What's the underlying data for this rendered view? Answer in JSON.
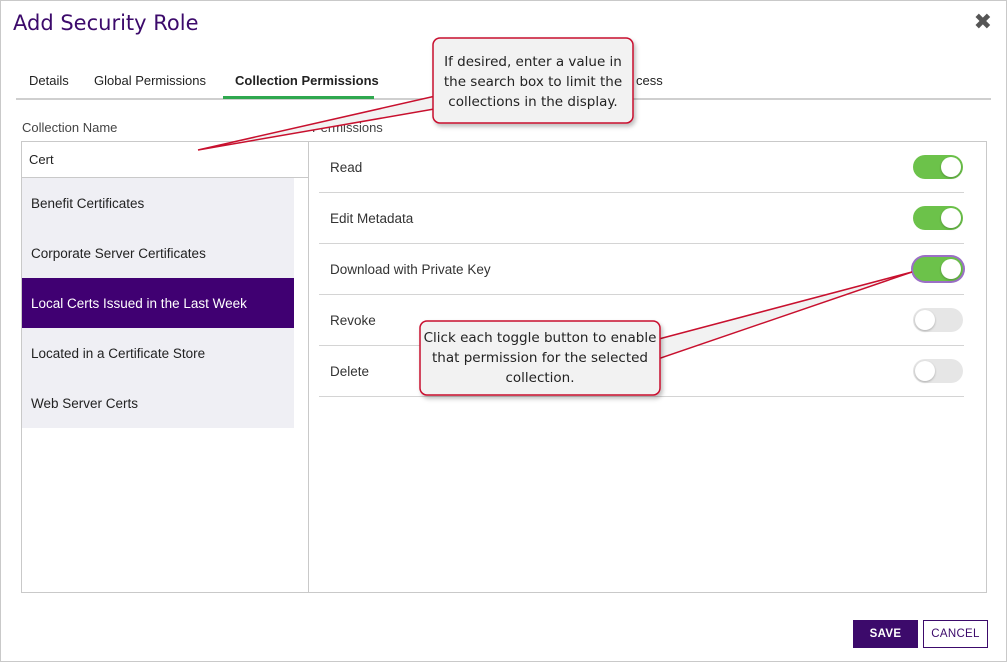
{
  "dialog": {
    "title": "Add Security Role",
    "close_glyph": "✖"
  },
  "tabs": [
    {
      "label": "Details"
    },
    {
      "label": "Global Permissions"
    },
    {
      "label": "Collection Permissions",
      "active": true
    },
    {
      "label": "cess"
    }
  ],
  "left_panel": {
    "header": "Collection Name",
    "search_value": "Cert",
    "items": [
      {
        "label": "Benefit Certificates"
      },
      {
        "label": "Corporate Server Certificates"
      },
      {
        "label": "Local Certs Issued in the Last Week",
        "selected": true
      },
      {
        "label": "Located in a Certificate Store"
      },
      {
        "label": "Web Server Certs"
      }
    ]
  },
  "right_panel": {
    "header": "Permissions",
    "permissions": [
      {
        "label": "Read",
        "enabled": true
      },
      {
        "label": "Edit Metadata",
        "enabled": true
      },
      {
        "label": "Download with Private Key",
        "enabled": true
      },
      {
        "label": "Revoke",
        "enabled": false
      },
      {
        "label": "Delete",
        "enabled": false
      }
    ]
  },
  "footer": {
    "save_label": "SAVE",
    "cancel_label": "CANCEL"
  },
  "callouts": {
    "search_tip": {
      "line1": "If desired, enter a value in",
      "line2": "the search box to limit the",
      "line3": "collections in the display."
    },
    "toggle_tip": {
      "line1": "Click each toggle button to enable",
      "line2": "that permission for the selected",
      "line3": "collection."
    }
  },
  "colors": {
    "brand_purple": "#3c0a6b",
    "selected_item": "#400072",
    "toggle_on": "#6cc24a",
    "tab_indicator": "#2fa84f",
    "callout_border": "#c8102e"
  }
}
